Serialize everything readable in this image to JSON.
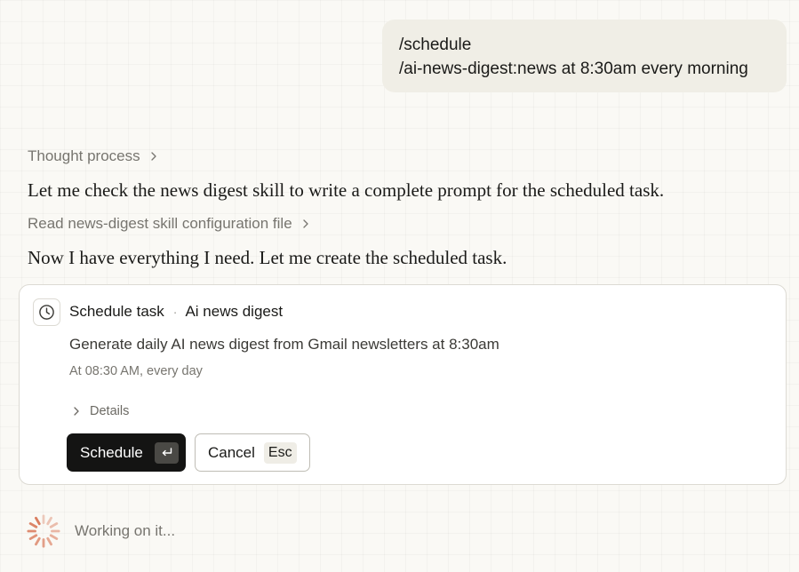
{
  "user_message": {
    "lines": [
      "/schedule",
      "/ai-news-digest:news at 8:30am every morning"
    ]
  },
  "thought_toggle": {
    "label": "Thought process"
  },
  "assistant": {
    "message_1": "Let me check the news digest skill to write a complete prompt for the scheduled task.",
    "tool_read_label": "Read news-digest skill configuration file",
    "message_2": "Now I have everything I need. Let me create the scheduled task."
  },
  "task_card": {
    "icon": "clock-icon",
    "title": "Schedule task",
    "separator": "·",
    "task_name": "Ai news digest",
    "description": "Generate daily AI news digest from Gmail newsletters at 8:30am",
    "schedule_text": "At 08:30 AM, every day",
    "details_label": "Details",
    "primary_button": {
      "label": "Schedule",
      "shortcut_icon": "return-key-icon"
    },
    "secondary_button": {
      "label": "Cancel",
      "shortcut": "Esc"
    }
  },
  "status": {
    "icon": "spinner-icon",
    "text": "Working on it...",
    "accent_color": "#d97757"
  }
}
